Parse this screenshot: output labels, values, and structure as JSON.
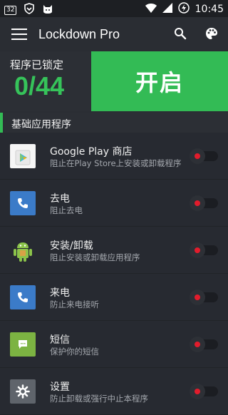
{
  "status_bar": {
    "badge": "32",
    "time": "10:45",
    "battery_icon": "battery-charging-icon"
  },
  "app_bar": {
    "title": "Lockdown Pro"
  },
  "hero": {
    "locked_label": "程序已锁定",
    "locked_count": "0/44",
    "enable_label": "开启"
  },
  "section": {
    "label": "基础应用程序"
  },
  "apps": [
    {
      "title": "Google Play 商店",
      "subtitle": "阻止在Play Store上安装或卸载程序",
      "icon": "google-play-icon",
      "color": "#ffffff"
    },
    {
      "title": "去电",
      "subtitle": "阻止去电",
      "icon": "phone-icon",
      "color": "#3b7bc8"
    },
    {
      "title": "安装/卸载",
      "subtitle": "阻止安装或卸载应用程序",
      "icon": "android-icon",
      "color": "#8bc34a"
    },
    {
      "title": "来电",
      "subtitle": "防止来电接听",
      "icon": "phone-icon",
      "color": "#3b7bc8"
    },
    {
      "title": "短信",
      "subtitle": "保护你的短信",
      "icon": "message-icon",
      "color": "#7cb342"
    },
    {
      "title": "设置",
      "subtitle": "防止卸载或强行中止本程序",
      "icon": "gear-icon",
      "color": "#5f646b"
    }
  ],
  "colors": {
    "accent": "#33bb55",
    "toggle_off": "#e21c2c"
  },
  "chevrons": "❮❮❮"
}
